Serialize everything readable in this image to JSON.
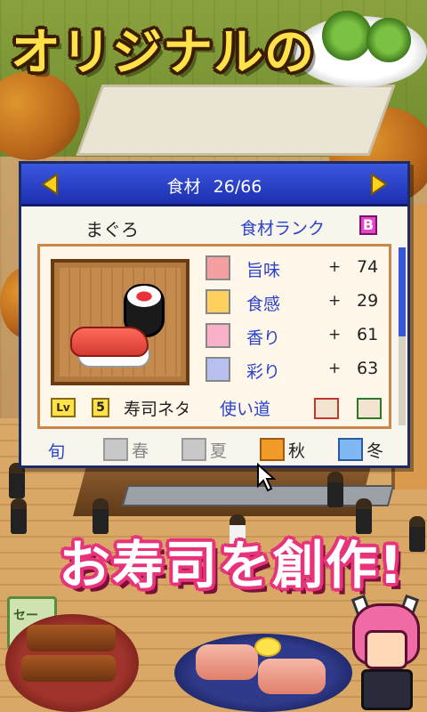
{
  "headline": "オリジナルの",
  "promo": "お寿司を創作!",
  "scene": {
    "sign_label": "セー"
  },
  "dialog": {
    "title": "食材",
    "counter": "26/66",
    "item_name": "まぐろ",
    "rank_label": "食材ランク",
    "rank_value": "B",
    "stats": [
      {
        "icon": "umami-icon",
        "label": "旨味",
        "sign": "+",
        "value": "74",
        "color": "#f4a0a0"
      },
      {
        "icon": "texture-icon",
        "label": "食感",
        "sign": "+",
        "value": "29",
        "color": "#ffd060"
      },
      {
        "icon": "aroma-icon",
        "label": "香り",
        "sign": "+",
        "value": "61",
        "color": "#f9b0c8"
      },
      {
        "icon": "color-sparkle-icon",
        "label": "彩り",
        "sign": "+",
        "value": "63",
        "color": "#b8c0f0"
      }
    ],
    "level_tag": "Lv",
    "level_value": "5",
    "category": "寿司ネタ",
    "usage_label": "使い道",
    "season_label": "旬",
    "seasons": [
      {
        "name": "春",
        "active": false,
        "icon": "blossom-icon"
      },
      {
        "name": "夏",
        "active": false,
        "icon": "wave-icon"
      },
      {
        "name": "秋",
        "active": true,
        "icon": "maple-leaf-icon"
      },
      {
        "name": "冬",
        "active": true,
        "icon": "snowflake-icon"
      }
    ]
  },
  "colors": {
    "title_bar": "#2a43c8",
    "accent_blue": "#2a43c8",
    "headline_yellow": "#ffe14a",
    "promo_pink": "#e8337a"
  }
}
